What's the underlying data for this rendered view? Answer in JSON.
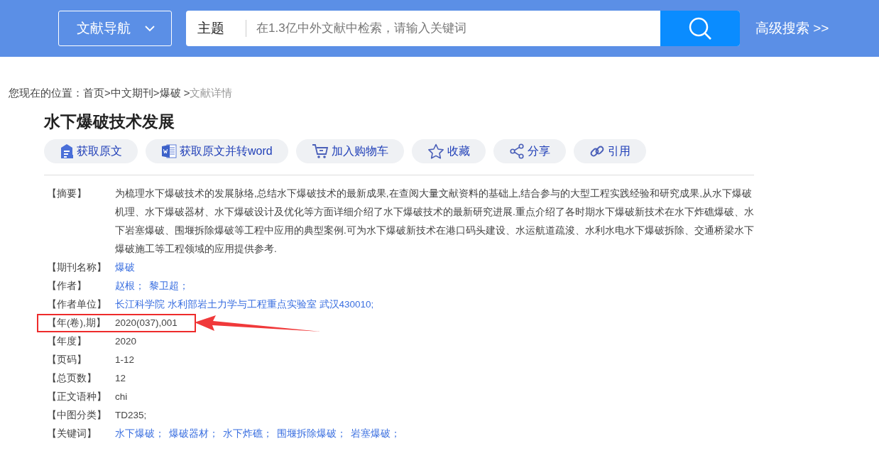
{
  "header": {
    "nav_label": "文献导航",
    "search_scope": "主题",
    "search_placeholder": "在1.3亿中外文献中检索，请输入关键词",
    "advanced_link": "高级搜索 >>"
  },
  "breadcrumb": {
    "prefix": "您现在的位置：",
    "items": [
      {
        "kind": "link",
        "text": "首页"
      },
      {
        "kind": "sep",
        "text": ">"
      },
      {
        "kind": "link",
        "text": "中文期刊"
      },
      {
        "kind": "sep",
        "text": ">"
      },
      {
        "kind": "link",
        "text": "爆破"
      },
      {
        "kind": "sep",
        "text": " >"
      },
      {
        "kind": "current",
        "text": "文献详情"
      }
    ]
  },
  "title": "水下爆破技术发展",
  "actions": [
    {
      "kind": "doc",
      "label": "获取原文"
    },
    {
      "kind": "word",
      "label": "获取原文并转word"
    },
    {
      "kind": "cart",
      "label": "加入购物车"
    },
    {
      "kind": "star",
      "label": "收藏"
    },
    {
      "kind": "share",
      "label": "分享"
    },
    {
      "kind": "link",
      "label": "引用"
    }
  ],
  "fields": [
    {
      "label": "【摘要】",
      "kind": "text",
      "highlighted": false,
      "value": "为梳理水下爆破技术的发展脉络,总结水下爆破技术的最新成果,在查阅大量文献资料的基础上,结合参与的大型工程实践经验和研究成果,从水下爆破机理、水下爆破器材、水下爆破设计及优化等方面详细介绍了水下爆破技术的最新研究进展.重点介绍了各时期水下爆破新技术在水下炸礁爆破、水下岩塞爆破、围堰拆除爆破等工程中应用的典型案例.可为水下爆破新技术在港口码头建设、水运航道疏浚、水利水电水下爆破拆除、交通桥梁水下爆破施工等工程领域的应用提供参考."
    },
    {
      "label": "【期刊名称】",
      "kind": "links",
      "highlighted": false,
      "values": [
        "爆破"
      ]
    },
    {
      "label": "【作者】",
      "kind": "links",
      "highlighted": false,
      "values": [
        "赵根；",
        "黎卫超；"
      ]
    },
    {
      "label": "【作者单位】",
      "kind": "links",
      "highlighted": false,
      "values": [
        "长江科学院 水利部岩土力学与工程重点实验室 武汉430010;"
      ]
    },
    {
      "label": "【年(卷),期】",
      "kind": "text",
      "highlighted": true,
      "value": "2020(037),001"
    },
    {
      "label": "【年度】",
      "kind": "text",
      "highlighted": false,
      "value": "2020"
    },
    {
      "label": "【页码】",
      "kind": "text",
      "highlighted": false,
      "value": "1-12"
    },
    {
      "label": "【总页数】",
      "kind": "text",
      "highlighted": false,
      "value": "12"
    },
    {
      "label": "【正文语种】",
      "kind": "text",
      "highlighted": false,
      "value": "chi"
    },
    {
      "label": "【中图分类】",
      "kind": "text",
      "highlighted": false,
      "value": "TD235;"
    },
    {
      "label": "【关键词】",
      "kind": "links",
      "highlighted": false,
      "values": [
        "水下爆破；",
        "爆破器材；",
        "水下炸礁；",
        "围堰拆除爆破；",
        "岩塞爆破；"
      ]
    }
  ]
}
